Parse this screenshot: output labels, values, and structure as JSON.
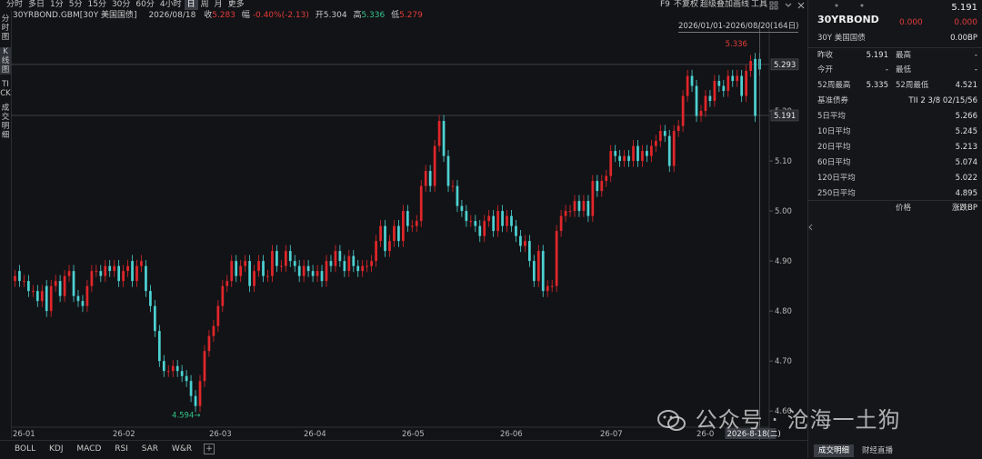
{
  "toolbar": {
    "periods": [
      "分时",
      "多日",
      "1分",
      "5分",
      "15分",
      "30分",
      "60分",
      "4小时",
      "日",
      "周",
      "月",
      "更多"
    ],
    "active_period": "日",
    "right_items": [
      "F9",
      "不复权",
      "超级叠加",
      "画线",
      "工具"
    ],
    "star_icon": "star-icon"
  },
  "info": {
    "symbol": "30YRBOND.GBM[30Y 美国国债]",
    "date": "2026/08/18",
    "close_label": "收",
    "close_value": "5.283",
    "change_label": "幅",
    "change_value": "-0.40%(-2.13)",
    "open_label": "开",
    "open_value": "5.304",
    "high_label": "高",
    "high_value": "5.336",
    "low_label": "低",
    "low_value": "5.279"
  },
  "left_tabs": [
    "分时图",
    "K线图",
    "TICK",
    "成交明细"
  ],
  "chart": {
    "range_label": "2026/01/01-2026/08/20(164日)",
    "hline_values": [
      5.293,
      5.191
    ],
    "hline_labels": [
      "5.293",
      "5.191"
    ],
    "high_mark": "5.336",
    "low_mark": "4.594",
    "date_marker": "2026-8-18(二)"
  },
  "chart_data": {
    "type": "candlestick",
    "x_ticks": [
      "26-01",
      "26-02",
      "26-03",
      "26-04",
      "26-05",
      "26-06",
      "26-07",
      "26-0"
    ],
    "y_ticks": [
      "5.20",
      "5.10",
      "5.00",
      "4.90",
      "4.80",
      "4.70",
      "4.60"
    ],
    "ylim": [
      4.575,
      5.36
    ],
    "up_color": "#e0262a",
    "down_color": "#4dd1d2",
    "candles_close": [
      4.87,
      4.86,
      4.86,
      4.84,
      4.84,
      4.82,
      4.84,
      4.8,
      4.85,
      4.86,
      4.83,
      4.87,
      4.88,
      4.83,
      4.82,
      4.81,
      4.85,
      4.88,
      4.88,
      4.87,
      4.89,
      4.88,
      4.89,
      4.86,
      4.88,
      4.89,
      4.86,
      4.89,
      4.9,
      4.84,
      4.81,
      4.76,
      4.7,
      4.68,
      4.68,
      4.69,
      4.68,
      4.67,
      4.66,
      4.63,
      4.61,
      4.66,
      4.72,
      4.75,
      4.77,
      4.81,
      4.85,
      4.86,
      4.9,
      4.87,
      4.89,
      4.9,
      4.85,
      4.88,
      4.9,
      4.87,
      4.87,
      4.92,
      4.89,
      4.89,
      4.92,
      4.9,
      4.89,
      4.87,
      4.89,
      4.88,
      4.87,
      4.88,
      4.86,
      4.9,
      4.89,
      4.92,
      4.9,
      4.88,
      4.91,
      4.89,
      4.88,
      4.89,
      4.89,
      4.9,
      4.94,
      4.97,
      4.92,
      4.94,
      4.97,
      4.94,
      5.0,
      4.97,
      4.97,
      4.98,
      5.05,
      5.08,
      5.05,
      5.13,
      5.18,
      5.11,
      5.05,
      5.05,
      5.01,
      5.0,
      4.98,
      4.98,
      4.97,
      4.95,
      4.98,
      4.99,
      4.96,
      5.0,
      4.97,
      4.99,
      4.97,
      4.95,
      4.93,
      4.94,
      4.9,
      4.86,
      4.92,
      4.84,
      4.85,
      4.85,
      4.96,
      4.99,
      5.0,
      5.0,
      5.02,
      5.0,
      5.02,
      4.99,
      5.06,
      5.04,
      5.06,
      5.07,
      5.12,
      5.11,
      5.1,
      5.11,
      5.1,
      5.13,
      5.1,
      5.12,
      5.11,
      5.13,
      5.14,
      5.16,
      5.15,
      5.09,
      5.16,
      5.17,
      5.23,
      5.27,
      5.25,
      5.19,
      5.2,
      5.23,
      5.22,
      5.26,
      5.25,
      5.24,
      5.27,
      5.26,
      5.27,
      5.23,
      5.28,
      5.3,
      5.19,
      5.283
    ],
    "candles_open": [
      4.86,
      4.88,
      4.86,
      4.86,
      4.84,
      4.84,
      4.82,
      4.85,
      4.8,
      4.85,
      4.86,
      4.83,
      4.87,
      4.88,
      4.83,
      4.82,
      4.81,
      4.85,
      4.88,
      4.88,
      4.87,
      4.89,
      4.88,
      4.89,
      4.86,
      4.88,
      4.9,
      4.86,
      4.89,
      4.89,
      4.84,
      4.81,
      4.76,
      4.7,
      4.68,
      4.68,
      4.69,
      4.68,
      4.67,
      4.66,
      4.63,
      4.61,
      4.66,
      4.72,
      4.75,
      4.77,
      4.81,
      4.85,
      4.86,
      4.9,
      4.87,
      4.89,
      4.9,
      4.85,
      4.88,
      4.9,
      4.87,
      4.87,
      4.92,
      4.89,
      4.89,
      4.92,
      4.9,
      4.89,
      4.87,
      4.89,
      4.88,
      4.87,
      4.88,
      4.86,
      4.9,
      4.89,
      4.92,
      4.9,
      4.88,
      4.91,
      4.89,
      4.88,
      4.89,
      4.89,
      4.9,
      4.94,
      4.97,
      4.92,
      4.94,
      4.97,
      4.94,
      5.0,
      4.97,
      4.97,
      4.98,
      5.05,
      5.08,
      5.05,
      5.13,
      5.18,
      5.11,
      5.05,
      5.05,
      5.01,
      5.0,
      4.98,
      4.98,
      4.97,
      4.95,
      4.98,
      4.99,
      4.96,
      5.0,
      4.97,
      4.99,
      4.97,
      4.95,
      4.93,
      4.94,
      4.9,
      4.86,
      4.92,
      4.84,
      4.85,
      4.85,
      4.96,
      4.99,
      5.0,
      5.0,
      5.02,
      5.0,
      5.02,
      4.99,
      5.06,
      5.04,
      5.06,
      5.07,
      5.12,
      5.11,
      5.1,
      5.11,
      5.1,
      5.13,
      5.1,
      5.12,
      5.11,
      5.13,
      5.14,
      5.16,
      5.15,
      5.09,
      5.16,
      5.17,
      5.23,
      5.27,
      5.25,
      5.19,
      5.2,
      5.23,
      5.22,
      5.26,
      5.25,
      5.24,
      5.27,
      5.26,
      5.27,
      5.23,
      5.28,
      5.304,
      5.304
    ]
  },
  "indicators": [
    "BOLL",
    "KDJ",
    "MACD",
    "RSI",
    "SAR",
    "W&R"
  ],
  "right_panel": {
    "title": "30YRBOND",
    "price": "5.191",
    "change_a": "0.000",
    "change_b": "0.000",
    "subtitle": "30Y 美国国债",
    "bp": "0.00BP",
    "rows": [
      {
        "l1": "昨收",
        "v1": "5.191",
        "l2": "最高",
        "v2": "-"
      },
      {
        "l1": "今开",
        "v1": "-",
        "l2": "最低",
        "v2": "-"
      },
      {
        "l1": "52周最高",
        "v1": "5.335",
        "l2": "52周最低",
        "v2": "4.521"
      }
    ],
    "bench_label": "基准债券",
    "bench_value": "TII 2 3/8 02/15/56",
    "averages": [
      {
        "l": "5日平均",
        "v": "5.266"
      },
      {
        "l": "10日平均",
        "v": "5.245"
      },
      {
        "l": "20日平均",
        "v": "5.213"
      },
      {
        "l": "60日平均",
        "v": "5.074"
      },
      {
        "l": "120日平均",
        "v": "5.022"
      },
      {
        "l": "250日平均",
        "v": "4.895"
      }
    ],
    "col_price": "价格",
    "col_bp": "涨跌BP",
    "bottom_tabs": [
      "成交明细",
      "财经直播"
    ]
  },
  "watermark": "公众号 · 沧海一土狗"
}
